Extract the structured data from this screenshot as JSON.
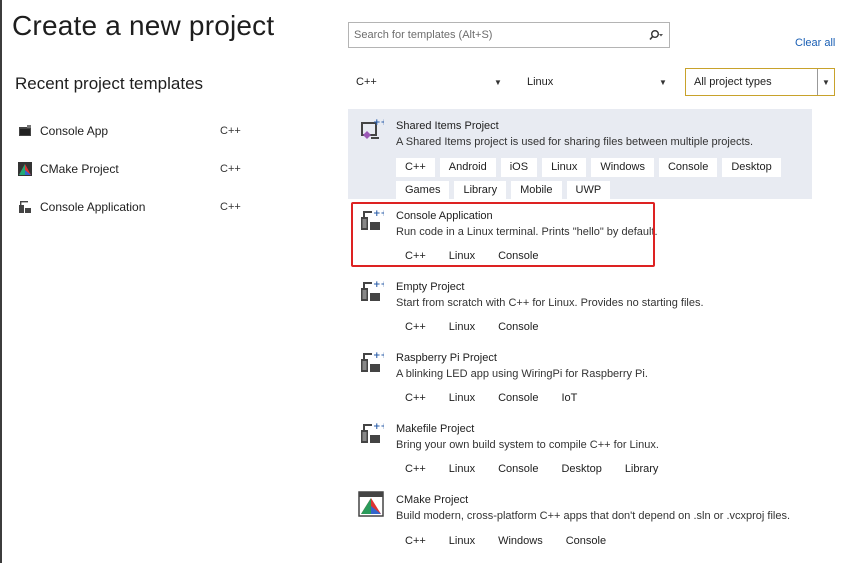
{
  "page_title": "Create a new project",
  "recent": {
    "title": "Recent project templates",
    "items": [
      {
        "name": "Console App",
        "lang": "C++",
        "icon": "console-app-icon"
      },
      {
        "name": "CMake Project",
        "lang": "C++",
        "icon": "cmake-icon"
      },
      {
        "name": "Console Application",
        "lang": "C++",
        "icon": "linux-console-icon"
      }
    ]
  },
  "search": {
    "placeholder": "Search for templates (Alt+S)",
    "icon": "search-icon"
  },
  "clear_all": "Clear all",
  "filters": {
    "language": "C++",
    "platform": "Linux",
    "project_type": "All project types"
  },
  "templates": [
    {
      "name": "Shared Items Project",
      "description": "A Shared Items project is used for sharing files between multiple projects.",
      "tags": [
        "C++",
        "Android",
        "iOS",
        "Linux",
        "Windows",
        "Console",
        "Desktop",
        "Games",
        "Library",
        "Mobile",
        "UWP"
      ],
      "icon": "shared-items-icon"
    },
    {
      "name": "Console Application",
      "description": "Run code in a Linux terminal. Prints \"hello\" by default.",
      "tags": [
        "C++",
        "Linux",
        "Console"
      ],
      "icon": "linux-console-icon"
    },
    {
      "name": "Empty Project",
      "description": "Start from scratch with C++ for Linux. Provides no starting files.",
      "tags": [
        "C++",
        "Linux",
        "Console"
      ],
      "icon": "linux-console-icon"
    },
    {
      "name": "Raspberry Pi Project",
      "description": "A blinking LED app using WiringPi for Raspberry Pi.",
      "tags": [
        "C++",
        "Linux",
        "Console",
        "IoT"
      ],
      "icon": "linux-console-icon"
    },
    {
      "name": "Makefile Project",
      "description": "Bring your own build system to compile C++ for Linux.",
      "tags": [
        "C++",
        "Linux",
        "Console",
        "Desktop",
        "Library"
      ],
      "icon": "linux-console-icon"
    },
    {
      "name": "CMake Project",
      "description": "Build modern, cross-platform C++ apps that don't depend on .sln or .vcxproj files.",
      "tags": [
        "C++",
        "Linux",
        "Windows",
        "Console"
      ],
      "icon": "cmake-icon"
    }
  ],
  "colors": {
    "accent": "#1a5fb4",
    "selected_bg": "#e8ebf2",
    "highlight_border": "#dd2222"
  }
}
